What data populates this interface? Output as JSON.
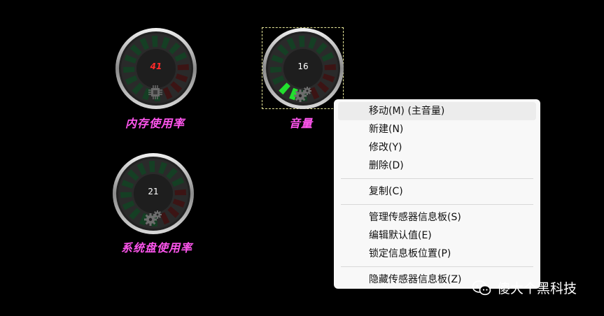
{
  "gauges": [
    {
      "id": "memory",
      "value": "41",
      "label": "内存使用率",
      "icon": "cpu-chip-icon",
      "value_style": "red",
      "active_segments": 0
    },
    {
      "id": "volume",
      "value": "16",
      "label": "音量",
      "icon": "gear-icon",
      "value_style": "white",
      "active_segments": 2
    },
    {
      "id": "disk",
      "value": "21",
      "label": "系统盘使用率",
      "icon": "gear-icon",
      "value_style": "white",
      "active_segments": 0
    }
  ],
  "colors": {
    "segment_green": "#153f24",
    "segment_red": "#3c1414",
    "segment_active": "#22e02e",
    "label": "#ff55ee",
    "selection": "#e8e89a"
  },
  "context_menu": {
    "group1": [
      "移动(M) (主音量)",
      "新建(N)",
      "修改(Y)",
      "删除(D)"
    ],
    "group2": [
      "复制(C)"
    ],
    "group3": [
      "管理传感器信息板(S)",
      "编辑默认值(E)",
      "锁定信息板位置(P)"
    ],
    "group4": [
      "隐藏传感器信息板(Z)"
    ]
  },
  "watermark": {
    "text": "傻大个黑科技",
    "icon": "wechat-icon"
  }
}
